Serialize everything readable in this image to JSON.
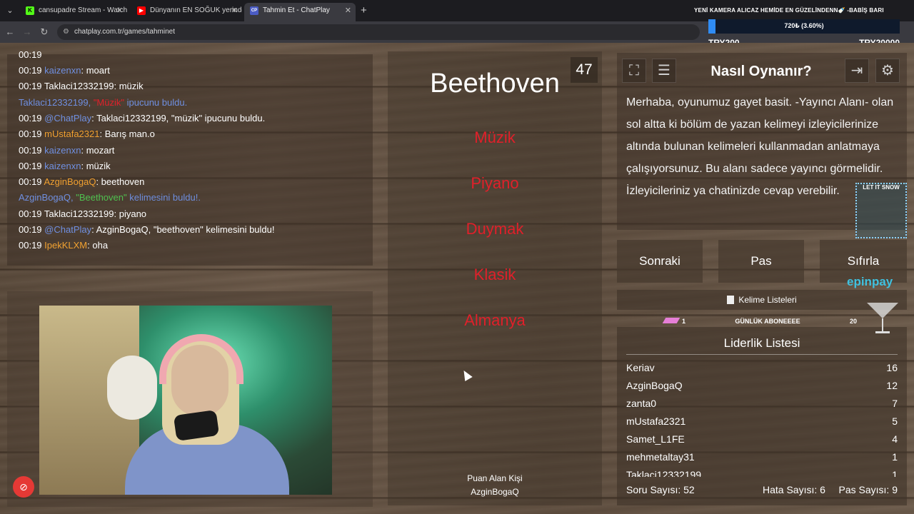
{
  "browser": {
    "tabs": [
      {
        "title": "cansupadre Stream - Watch Liv",
        "favicon": "K",
        "color": "#53fc18",
        "active": false
      },
      {
        "title": "Dünyanın EN SOĞUK yerinde B",
        "favicon": "▶",
        "color": "#ff0000",
        "active": false
      },
      {
        "title": "Tahmin Et - ChatPlay",
        "favicon": "CP",
        "color": "#4b5cc4",
        "active": true
      }
    ],
    "url": "chatplay.com.tr/games/tahminet"
  },
  "overlay": {
    "title": "YENİ KAMERA ALICAZ HEMİDE EN GÜZELİNDENN🍼 -BABİŞ BARI",
    "progress_text": "720₺ (3.60%)",
    "progress_fraction": 0.036,
    "min_label": "TRY200",
    "max_label": "TRY20000",
    "snow_label": "LET IT SNOW",
    "brand": "epinpay"
  },
  "chat": {
    "partial_top": "00:19 ",
    "lines": [
      {
        "time": "00:19 ",
        "user": "kaizenxn",
        "user_color": "#6f8fe0",
        "text": ": moart"
      },
      {
        "time": "00:19 ",
        "user": "Taklaci12332199",
        "user_color": "#ffffff",
        "text": ": müzik"
      },
      {
        "time": "",
        "user": "Taklaci12332199, ",
        "user_color": "#6f8fe0",
        "highlight": "\"Müzik\"",
        "highlight_color": "#e0202a",
        "text": " ipucunu buldu.",
        "text_color": "#6f8fe0"
      },
      {
        "time": "00:19 ",
        "user": "@ChatPlay",
        "user_color": "#6f8fe0",
        "text": ": Taklaci12332199, \"müzik\" ipucunu buldu."
      },
      {
        "time": "00:19 ",
        "user": "mUstafa2321",
        "user_color": "#f0a030",
        "text": ": Barış man.o"
      },
      {
        "time": "00:19 ",
        "user": "kaizenxn",
        "user_color": "#6f8fe0",
        "text": ": mozart"
      },
      {
        "time": "00:19 ",
        "user": "kaizenxn",
        "user_color": "#6f8fe0",
        "text": ": müzik"
      },
      {
        "time": "00:19 ",
        "user": "AzginBogaQ",
        "user_color": "#f0a030",
        "text": ": beethoven"
      },
      {
        "time": "",
        "user": "AzginBogaQ, ",
        "user_color": "#6f8fe0",
        "highlight": "\"Beethoven\"",
        "highlight_color": "#4fc04f",
        "text": " kelimesini buldu!.",
        "text_color": "#6f8fe0"
      },
      {
        "time": "00:19 ",
        "user": "Taklaci12332199",
        "user_color": "#ffffff",
        "text": ": piyano"
      },
      {
        "time": "00:19 ",
        "user": "@ChatPlay",
        "user_color": "#6f8fe0",
        "text": ": AzginBogaQ, \"beethoven\" kelimesini buldu!"
      },
      {
        "time": "00:19 ",
        "user": "IpekKLXM",
        "user_color": "#f0a030",
        "text": ": oha"
      }
    ]
  },
  "game": {
    "counter": "47",
    "word": "Beethoven",
    "taboo": [
      "Müzik",
      "Piyano",
      "Duymak",
      "Klasik",
      "Almanya"
    ],
    "scorer_label": "Puan Alan Kişi",
    "scorer_name": "AzginBogaQ"
  },
  "how": {
    "title": "Nasıl Oynanır?",
    "text": "Merhaba, oyunumuz gayet basit. -Yayıncı Alanı- olan sol altta ki bölüm de yazan kelimeyi izleyicilerinize altında bulunan kelimeleri kullanmadan anlatmaya çalışıyorsunuz. Bu alanı sadece yayıncı görmelidir. İzleyicileriniz ya chatinizde cevap verebilir."
  },
  "actions": {
    "next": "Sonraki",
    "pass": "Pas",
    "reset": "Sıfırla"
  },
  "word_lists": "Kelime Listeleri",
  "goal": {
    "left": "1",
    "name": "GÜNLÜK ABONEEEE",
    "right": "20"
  },
  "leaderboard": {
    "title": "Liderlik Listesi",
    "rows": [
      {
        "name": "Keriav",
        "score": "16"
      },
      {
        "name": "AzginBogaQ",
        "score": "12"
      },
      {
        "name": "zanta0",
        "score": "7"
      },
      {
        "name": "mUstafa2321",
        "score": "5"
      },
      {
        "name": "Samet_L1FE",
        "score": "4"
      },
      {
        "name": "mehmetaltay31",
        "score": "1"
      },
      {
        "name": "Taklaci12332199",
        "score": "1"
      }
    ]
  },
  "stats": {
    "questions": "Soru Sayısı: 52",
    "errors": "Hata Sayısı: 6",
    "passes": "Pas Sayısı: 9"
  }
}
